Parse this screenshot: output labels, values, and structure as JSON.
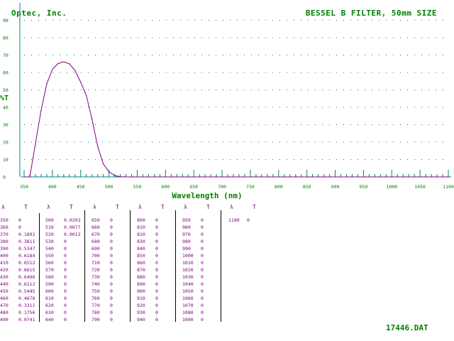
{
  "header": {
    "company": "Optec, Inc.",
    "title": "BESSEL B FILTER, 50mm SIZE"
  },
  "footer": {
    "file_name": "17446.DAT"
  },
  "colors": {
    "curve": "#800080",
    "labels": "#008000",
    "axis": "#008080",
    "table_text": "#800080"
  },
  "chart_data": {
    "type": "line",
    "title": "BESSEL B FILTER, 50mm SIZE",
    "xlabel": "Wavelength (nm)",
    "ylabel": "%T",
    "xlim": [
      350,
      1100
    ],
    "ylim": [
      0,
      100
    ],
    "xticks": [
      350,
      400,
      450,
      500,
      550,
      600,
      650,
      700,
      750,
      800,
      850,
      900,
      950,
      1000,
      1050,
      1100
    ],
    "yticks": [
      0,
      10,
      20,
      30,
      40,
      50,
      60,
      70,
      80,
      90
    ],
    "grid": true,
    "series": [
      {
        "x": [
          350,
          360,
          370,
          380,
          390,
          400,
          410,
          420,
          430,
          440,
          450,
          460,
          470,
          480,
          490,
          500,
          510,
          520,
          530,
          540,
          550,
          600,
          700,
          800,
          900,
          1000,
          1100
        ],
        "values": [
          0,
          0,
          18.92,
          38.11,
          53.47,
          61.84,
          65.12,
          66.15,
          64.96,
          61.12,
          54.45,
          46.78,
          33.11,
          17.56,
          7.41,
          2.93,
          0.77,
          0.13,
          0,
          0,
          0,
          0,
          0,
          0,
          0,
          0,
          0
        ]
      }
    ]
  },
  "table": {
    "lambda_symbol": "λ",
    "t_symbol": "T",
    "columns": [
      {
        "rows": [
          [
            "350",
            "0"
          ],
          [
            "360",
            "0"
          ],
          [
            "370",
            "0.1892"
          ],
          [
            "380",
            "0.3811"
          ],
          [
            "390",
            "0.5347"
          ],
          [
            "400",
            "0.6184"
          ],
          [
            "410",
            "0.6512"
          ],
          [
            "420",
            "0.6615"
          ],
          [
            "430",
            "0.6496"
          ],
          [
            "440",
            "0.6112"
          ],
          [
            "450",
            "0.5445"
          ],
          [
            "460",
            "0.4678"
          ],
          [
            "470",
            "0.3311"
          ],
          [
            "480",
            "0.1756"
          ],
          [
            "490",
            "0.0741"
          ]
        ]
      },
      {
        "rows": [
          [
            "500",
            "0.0293"
          ],
          [
            "510",
            "0.0077"
          ],
          [
            "520",
            "0.0013"
          ],
          [
            "530",
            "0"
          ],
          [
            "540",
            "0"
          ],
          [
            "550",
            "0"
          ],
          [
            "560",
            "0"
          ],
          [
            "570",
            "0"
          ],
          [
            "580",
            "0"
          ],
          [
            "590",
            "0"
          ],
          [
            "600",
            "0"
          ],
          [
            "610",
            "0"
          ],
          [
            "620",
            "0"
          ],
          [
            "630",
            "0"
          ],
          [
            "640",
            "0"
          ]
        ]
      },
      {
        "rows": [
          [
            "650",
            "0"
          ],
          [
            "660",
            "0"
          ],
          [
            "670",
            "0"
          ],
          [
            "680",
            "0"
          ],
          [
            "690",
            "0"
          ],
          [
            "700",
            "0"
          ],
          [
            "710",
            "0"
          ],
          [
            "720",
            "0"
          ],
          [
            "730",
            "0"
          ],
          [
            "740",
            "0"
          ],
          [
            "750",
            "0"
          ],
          [
            "760",
            "0"
          ],
          [
            "770",
            "0"
          ],
          [
            "780",
            "0"
          ],
          [
            "790",
            "0"
          ]
        ]
      },
      {
        "rows": [
          [
            "800",
            "0"
          ],
          [
            "810",
            "0"
          ],
          [
            "820",
            "0"
          ],
          [
            "830",
            "0"
          ],
          [
            "840",
            "0"
          ],
          [
            "850",
            "0"
          ],
          [
            "860",
            "0"
          ],
          [
            "870",
            "0"
          ],
          [
            "880",
            "0"
          ],
          [
            "890",
            "0"
          ],
          [
            "900",
            "0"
          ],
          [
            "910",
            "0"
          ],
          [
            "920",
            "0"
          ],
          [
            "930",
            "0"
          ],
          [
            "940",
            "0"
          ]
        ]
      },
      {
        "rows": [
          [
            "950",
            "0"
          ],
          [
            "960",
            "0"
          ],
          [
            "970",
            "0"
          ],
          [
            "980",
            "0"
          ],
          [
            "990",
            "0"
          ],
          [
            "1000",
            "0"
          ],
          [
            "1010",
            "0"
          ],
          [
            "1020",
            "0"
          ],
          [
            "1030",
            "0"
          ],
          [
            "1040",
            "0"
          ],
          [
            "1050",
            "0"
          ],
          [
            "1060",
            "0"
          ],
          [
            "1070",
            "0"
          ],
          [
            "1080",
            "0"
          ],
          [
            "1090",
            "0"
          ]
        ]
      },
      {
        "rows": [
          [
            "1100",
            "0"
          ]
        ]
      }
    ]
  }
}
